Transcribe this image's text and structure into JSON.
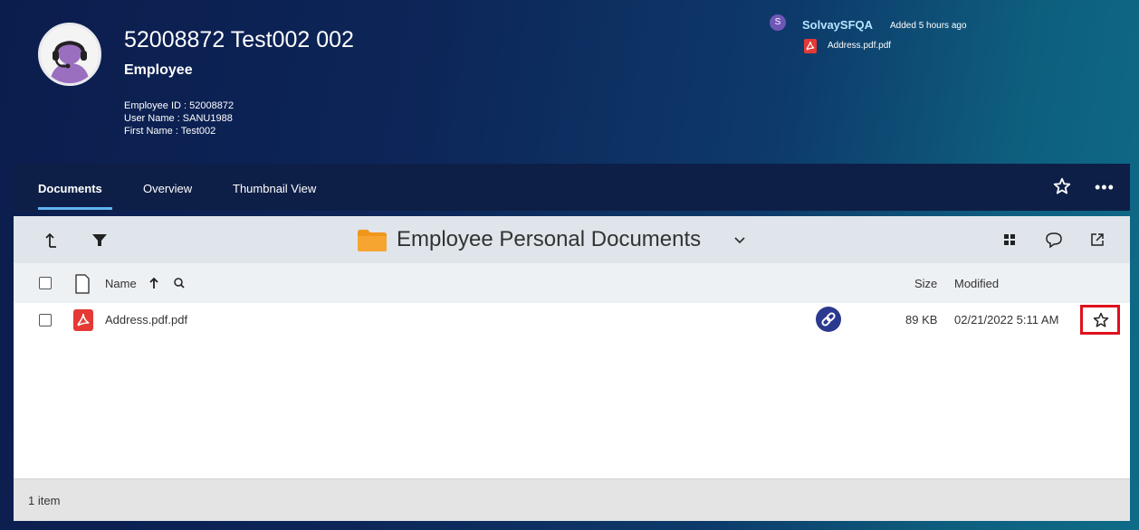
{
  "header": {
    "title": "52008872 Test002 002",
    "subtitle": "Employee",
    "meta": {
      "employee_id": "Employee ID : 52008872",
      "user_name": "User Name : SANU1988",
      "first_name": "First Name : Test002"
    }
  },
  "activity": {
    "initial": "S",
    "user": "SolvaySFQA",
    "note": "Added 5 hours ago",
    "file": "Address.pdf.pdf"
  },
  "tabs": [
    {
      "label": "Documents",
      "active": true
    },
    {
      "label": "Overview",
      "active": false
    },
    {
      "label": "Thumbnail View",
      "active": false
    }
  ],
  "tab_actions": {
    "more": "•••"
  },
  "toolbar": {
    "folder": "Employee Personal Documents"
  },
  "columns": {
    "name": "Name",
    "size": "Size",
    "modified": "Modified"
  },
  "rows": [
    {
      "name": "Address.pdf.pdf",
      "size": "89 KB",
      "modified": "02/21/2022 5:11 AM"
    }
  ],
  "footer": {
    "count": "1 item"
  },
  "colors": {
    "header_bg": "#0d2558",
    "tab_bar": "#0e1f47",
    "accent_underline": "#5fb4f2",
    "pdf_red": "#e53935",
    "folder_orange": "#f0961d",
    "highlight_red": "#e0101d",
    "link_badge": "#2b3a8f"
  },
  "icons": [
    "headset-avatar-icon",
    "pdf-icon",
    "star-icon",
    "more-icon",
    "up-arrow-icon",
    "filter-icon",
    "folder-icon",
    "chevron-down-icon",
    "grid-view-icon",
    "comment-icon",
    "open-external-icon",
    "file-icon",
    "sort-asc-icon",
    "search-icon",
    "link-icon"
  ]
}
